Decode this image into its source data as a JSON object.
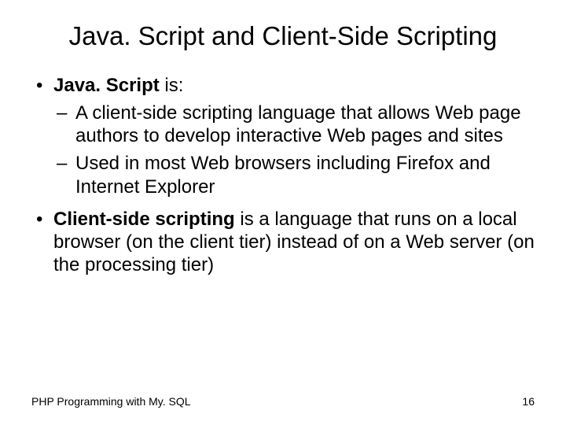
{
  "title": "Java. Script and Client-Side Scripting",
  "bullets": {
    "b1_pre": "Java. Script",
    "b1_post": " is:",
    "b1_sub1": "A client-side scripting language that allows Web page authors to develop interactive Web pages and sites",
    "b1_sub2": "Used in most Web browsers including Firefox and Internet Explorer",
    "b2_bold": "Client-side scripting",
    "b2_rest": " is a language that runs on a local browser (on the client tier) instead of on a Web server (on the processing tier)"
  },
  "footer": {
    "left": "PHP Programming with My. SQL",
    "page": "16"
  }
}
